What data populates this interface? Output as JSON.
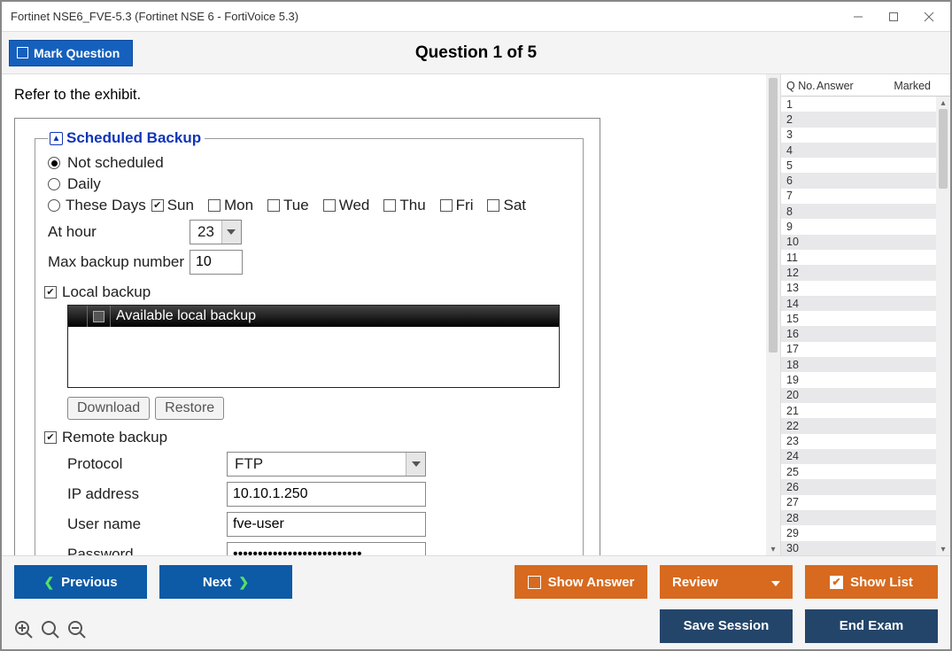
{
  "window": {
    "title": "Fortinet NSE6_FVE-5.3 (Fortinet NSE 6 - FortiVoice 5.3)"
  },
  "header": {
    "mark_label": "Mark Question",
    "question_title": "Question 1 of 5"
  },
  "question": {
    "intro": "Refer to the exhibit."
  },
  "exhibit": {
    "legend": "Scheduled Backup",
    "opts": {
      "not_scheduled": "Not scheduled",
      "daily": "Daily",
      "these_days": "These Days"
    },
    "days": {
      "sun": "Sun",
      "mon": "Mon",
      "tue": "Tue",
      "wed": "Wed",
      "thu": "Thu",
      "fri": "Fri",
      "sat": "Sat"
    },
    "at_hour_label": "At hour",
    "at_hour_value": "23",
    "max_backup_label": "Max backup number",
    "max_backup_value": "10",
    "local_backup_label": "Local backup",
    "local_table_header": "Available local backup",
    "download_btn": "Download",
    "restore_btn": "Restore",
    "remote_backup_label": "Remote backup",
    "protocol_label": "Protocol",
    "protocol_value": "FTP",
    "ip_label": "IP address",
    "ip_value": "10.10.1.250",
    "user_label": "User name",
    "user_value": "fve-user",
    "password_label": "Password",
    "password_value": "••••••••••••••••••••••••••"
  },
  "list": {
    "col1": "Q No.",
    "col2": "Answer",
    "col3": "Marked",
    "rows": [
      "1",
      "2",
      "3",
      "4",
      "5",
      "6",
      "7",
      "8",
      "9",
      "10",
      "11",
      "12",
      "13",
      "14",
      "15",
      "16",
      "17",
      "18",
      "19",
      "20",
      "21",
      "22",
      "23",
      "24",
      "25",
      "26",
      "27",
      "28",
      "29",
      "30"
    ]
  },
  "footer": {
    "previous": "Previous",
    "next": "Next",
    "show_answer": "Show Answer",
    "review": "Review",
    "show_list": "Show List",
    "save_session": "Save Session",
    "end_exam": "End Exam"
  }
}
